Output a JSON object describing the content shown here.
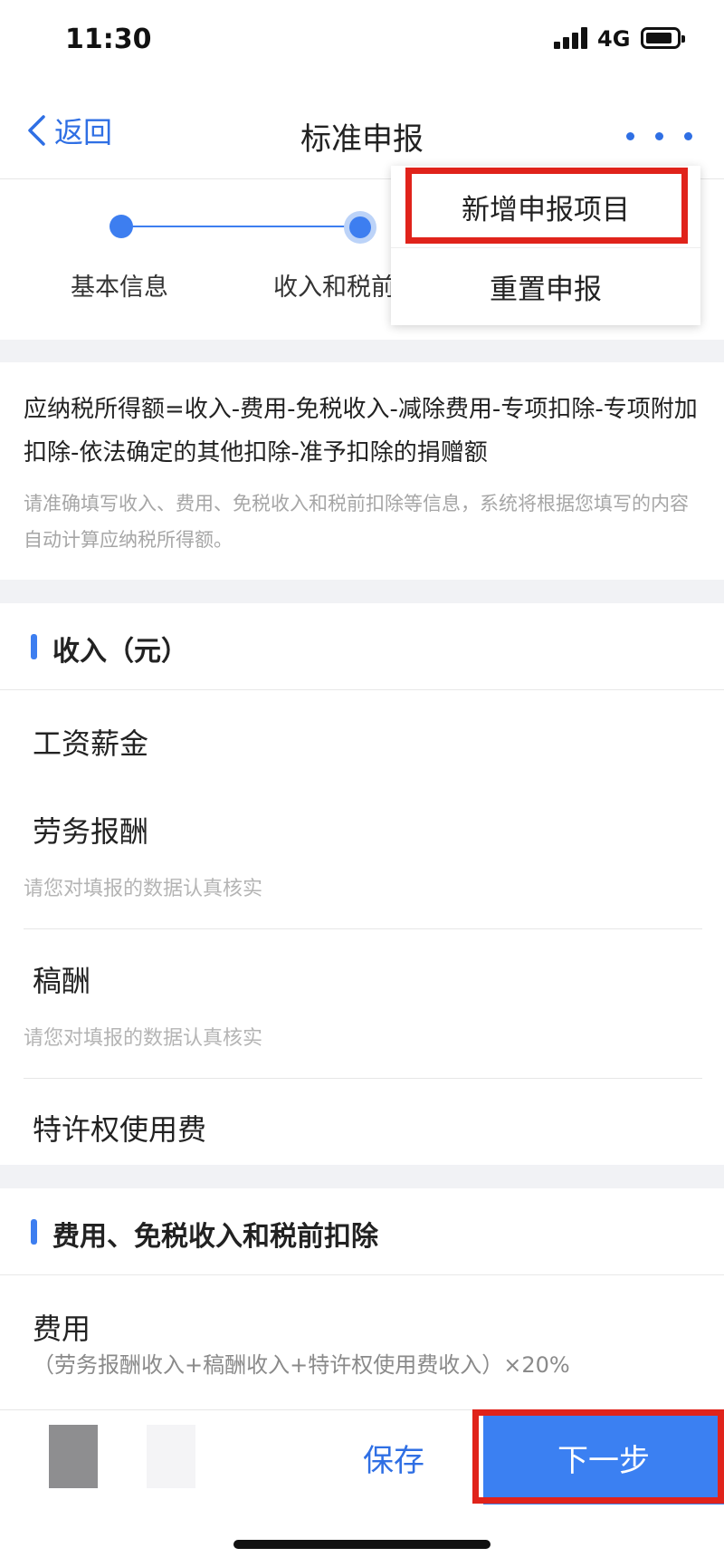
{
  "status_bar": {
    "time": "11:30",
    "network": "4G"
  },
  "nav": {
    "back_label": "返回",
    "title": "标准申报"
  },
  "menu": {
    "items": [
      {
        "label": "新增申报项目"
      },
      {
        "label": "重置申报"
      }
    ]
  },
  "steps": [
    {
      "label": "基本信息"
    },
    {
      "label": "收入和税前"
    }
  ],
  "formula": {
    "text": "应纳税所得额=收入-费用-免税收入-减除费用-专项扣除-专项附加扣除-依法确定的其他扣除-准予扣除的捐赠额",
    "hint": "请准确填写收入、费用、免税收入和税前扣除等信息，系统将根据您填写的内容自动计算应纳税所得额。"
  },
  "income": {
    "title": "收入（元）",
    "items": [
      {
        "label": "工资薪金",
        "hint": ""
      },
      {
        "label": "劳务报酬",
        "hint": "请您对填报的数据认真核实"
      },
      {
        "label": "稿酬",
        "hint": "请您对填报的数据认真核实"
      },
      {
        "label": "特许权使用费",
        "hint": ""
      }
    ]
  },
  "expense": {
    "title": "费用、免税收入和税前扣除",
    "label": "费用",
    "sub": "（劳务报酬收入+稿酬收入+特许权使用费收入）×20%"
  },
  "bottom": {
    "save_label": "保存",
    "next_label": "下一步"
  },
  "colors": {
    "accent": "#3d7ef0",
    "highlight": "#e0231b"
  }
}
